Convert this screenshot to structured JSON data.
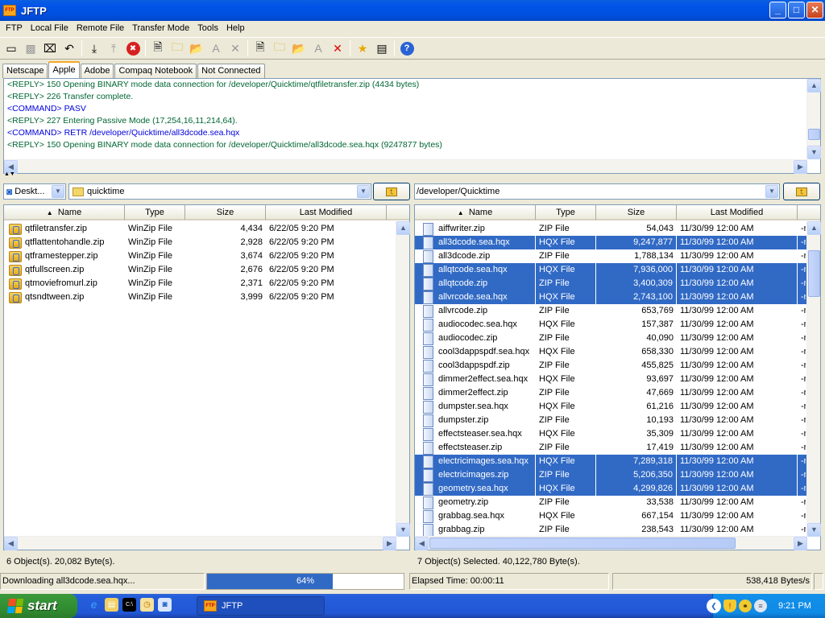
{
  "window": {
    "title": "JFTP",
    "app_icon": "FTP"
  },
  "menu": [
    "FTP",
    "Local File",
    "Remote File",
    "Transfer Mode",
    "Tools",
    "Help"
  ],
  "toolbar": [
    {
      "name": "new-connection",
      "glyph": "▭",
      "enabled": true
    },
    {
      "name": "disconnect",
      "glyph": "▩",
      "enabled": false
    },
    {
      "name": "disconnect-all",
      "glyph": "⌧",
      "enabled": true
    },
    {
      "name": "undo",
      "glyph": "↶",
      "enabled": true
    },
    "sep",
    {
      "name": "download",
      "glyph": "⤓",
      "enabled": true
    },
    {
      "name": "upload",
      "glyph": "⤒",
      "enabled": false
    },
    {
      "name": "stop",
      "glyph": "✖",
      "enabled": true
    },
    "sep",
    {
      "name": "local-new-file",
      "glyph": "🗎",
      "enabled": true
    },
    {
      "name": "local-new-folder",
      "glyph": "🗀",
      "enabled": true
    },
    {
      "name": "local-open-folder",
      "glyph": "📂",
      "enabled": true
    },
    {
      "name": "local-rename",
      "glyph": "A",
      "enabled": false
    },
    {
      "name": "local-delete",
      "glyph": "✕",
      "enabled": false
    },
    "sep",
    {
      "name": "remote-new-file",
      "glyph": "🗎",
      "enabled": true
    },
    {
      "name": "remote-new-folder",
      "glyph": "🗀",
      "enabled": true
    },
    {
      "name": "remote-open-folder",
      "glyph": "📂",
      "enabled": true
    },
    {
      "name": "remote-rename",
      "glyph": "A",
      "enabled": false
    },
    {
      "name": "remote-delete",
      "glyph": "✕",
      "enabled": true
    },
    "sep",
    {
      "name": "favorites",
      "glyph": "★",
      "enabled": true
    },
    {
      "name": "log-view",
      "glyph": "▤",
      "enabled": true
    },
    "sep",
    {
      "name": "help",
      "glyph": "?",
      "enabled": true
    }
  ],
  "tabs": [
    {
      "label": "Netscape",
      "active": false
    },
    {
      "label": "Apple",
      "active": true
    },
    {
      "label": "Adobe",
      "active": false
    },
    {
      "label": "Compaq Notebook",
      "active": false
    },
    {
      "label": "Not Connected",
      "active": false
    }
  ],
  "log": [
    {
      "kind": "reply",
      "text": "<REPLY> 150 Opening BINARY mode data connection for /developer/Quicktime/qtfiletransfer.zip (4434 bytes)"
    },
    {
      "kind": "reply",
      "text": "<REPLY> 226 Transfer complete."
    },
    {
      "kind": "cmd",
      "text": "<COMMAND> PASV"
    },
    {
      "kind": "reply",
      "text": "<REPLY> 227 Entering Passive Mode (17,254,16,11,214,64)."
    },
    {
      "kind": "cmd",
      "text": "<COMMAND> RETR /developer/Quicktime/all3dcode.sea.hqx"
    },
    {
      "kind": "reply",
      "text": "<REPLY> 150 Opening BINARY mode data connection for /developer/Quicktime/all3dcode.sea.hqx (9247877 bytes)"
    }
  ],
  "local": {
    "drive": "Deskt...",
    "folder": "quicktime",
    "columns": [
      "Name",
      "Type",
      "Size",
      "Last Modified"
    ],
    "files": [
      {
        "name": "qtfiletransfer.zip",
        "type": "WinZip File",
        "size": "4,434",
        "modified": "6/22/05 9:20 PM"
      },
      {
        "name": "qtflattentohandle.zip",
        "type": "WinZip File",
        "size": "2,928",
        "modified": "6/22/05 9:20 PM"
      },
      {
        "name": "qtframestepper.zip",
        "type": "WinZip File",
        "size": "3,674",
        "modified": "6/22/05 9:20 PM"
      },
      {
        "name": "qtfullscreen.zip",
        "type": "WinZip File",
        "size": "2,676",
        "modified": "6/22/05 9:20 PM"
      },
      {
        "name": "qtmoviefromurl.zip",
        "type": "WinZip File",
        "size": "2,371",
        "modified": "6/22/05 9:20 PM"
      },
      {
        "name": "qtsndtween.zip",
        "type": "WinZip File",
        "size": "3,999",
        "modified": "6/22/05 9:20 PM"
      }
    ],
    "status": "6 Object(s). 20,082 Byte(s)."
  },
  "remote": {
    "path": "/developer/Quicktime",
    "columns": [
      "Name",
      "Type",
      "Size",
      "Last Modified",
      ""
    ],
    "files": [
      {
        "name": "aiffwriter.zip",
        "type": "ZIP File",
        "size": "54,043",
        "modified": "11/30/99 12:00 AM",
        "perm": "-r",
        "selected": false
      },
      {
        "name": "all3dcode.sea.hqx",
        "type": "HQX File",
        "size": "9,247,877",
        "modified": "11/30/99 12:00 AM",
        "perm": "-r",
        "selected": true
      },
      {
        "name": "all3dcode.zip",
        "type": "ZIP File",
        "size": "1,788,134",
        "modified": "11/30/99 12:00 AM",
        "perm": "-r",
        "selected": false
      },
      {
        "name": "allqtcode.sea.hqx",
        "type": "HQX File",
        "size": "7,936,000",
        "modified": "11/30/99 12:00 AM",
        "perm": "-r",
        "selected": true
      },
      {
        "name": "allqtcode.zip",
        "type": "ZIP File",
        "size": "3,400,309",
        "modified": "11/30/99 12:00 AM",
        "perm": "-r",
        "selected": true
      },
      {
        "name": "allvrcode.sea.hqx",
        "type": "HQX File",
        "size": "2,743,100",
        "modified": "11/30/99 12:00 AM",
        "perm": "-r",
        "selected": true
      },
      {
        "name": "allvrcode.zip",
        "type": "ZIP File",
        "size": "653,769",
        "modified": "11/30/99 12:00 AM",
        "perm": "-r",
        "selected": false
      },
      {
        "name": "audiocodec.sea.hqx",
        "type": "HQX File",
        "size": "157,387",
        "modified": "11/30/99 12:00 AM",
        "perm": "-r",
        "selected": false
      },
      {
        "name": "audiocodec.zip",
        "type": "ZIP File",
        "size": "40,090",
        "modified": "11/30/99 12:00 AM",
        "perm": "-r",
        "selected": false
      },
      {
        "name": "cool3dappspdf.sea.hqx",
        "type": "HQX File",
        "size": "658,330",
        "modified": "11/30/99 12:00 AM",
        "perm": "-r",
        "selected": false
      },
      {
        "name": "cool3dappspdf.zip",
        "type": "ZIP File",
        "size": "455,825",
        "modified": "11/30/99 12:00 AM",
        "perm": "-r",
        "selected": false
      },
      {
        "name": "dimmer2effect.sea.hqx",
        "type": "HQX File",
        "size": "93,697",
        "modified": "11/30/99 12:00 AM",
        "perm": "-r",
        "selected": false
      },
      {
        "name": "dimmer2effect.zip",
        "type": "ZIP File",
        "size": "47,669",
        "modified": "11/30/99 12:00 AM",
        "perm": "-r",
        "selected": false
      },
      {
        "name": "dumpster.sea.hqx",
        "type": "HQX File",
        "size": "61,216",
        "modified": "11/30/99 12:00 AM",
        "perm": "-r",
        "selected": false
      },
      {
        "name": "dumpster.zip",
        "type": "ZIP File",
        "size": "10,193",
        "modified": "11/30/99 12:00 AM",
        "perm": "-r",
        "selected": false
      },
      {
        "name": "effectsteaser.sea.hqx",
        "type": "HQX File",
        "size": "35,309",
        "modified": "11/30/99 12:00 AM",
        "perm": "-r",
        "selected": false
      },
      {
        "name": "effectsteaser.zip",
        "type": "ZIP File",
        "size": "17,419",
        "modified": "11/30/99 12:00 AM",
        "perm": "-r",
        "selected": false
      },
      {
        "name": "electricimages.sea.hqx",
        "type": "HQX File",
        "size": "7,289,318",
        "modified": "11/30/99 12:00 AM",
        "perm": "-r",
        "selected": true
      },
      {
        "name": "electricimages.zip",
        "type": "ZIP File",
        "size": "5,206,350",
        "modified": "11/30/99 12:00 AM",
        "perm": "-r",
        "selected": true
      },
      {
        "name": "geometry.sea.hqx",
        "type": "HQX File",
        "size": "4,299,826",
        "modified": "11/30/99 12:00 AM",
        "perm": "-r",
        "selected": true
      },
      {
        "name": "geometry.zip",
        "type": "ZIP File",
        "size": "33,538",
        "modified": "11/30/99 12:00 AM",
        "perm": "-r",
        "selected": false
      },
      {
        "name": "grabbag.sea.hqx",
        "type": "HQX File",
        "size": "667,154",
        "modified": "11/30/99 12:00 AM",
        "perm": "-r",
        "selected": false
      },
      {
        "name": "grabbag.zip",
        "type": "ZIP File",
        "size": "238,543",
        "modified": "11/30/99 12:00 AM",
        "perm": "-r",
        "selected": false
      }
    ],
    "status": "7 Object(s) Selected. 40,122,780 Byte(s)."
  },
  "transfer": {
    "status": "Downloading all3dcode.sea.hqx...",
    "progress_percent": 64,
    "progress_label": "64%",
    "elapsed": "Elapsed Time: 00:00:11",
    "rate": "538,418 Bytes/s"
  },
  "taskbar": {
    "start_label": "start",
    "quick_launch": [
      "internet-explorer",
      "explorer",
      "command-prompt",
      "clock",
      "jftp-launcher"
    ],
    "task_label": "JFTP",
    "clock": "9:21 PM"
  },
  "colors": {
    "selection": "#316ac5",
    "reply": "#006633",
    "command": "#0000dd",
    "title": "#0053e8"
  }
}
